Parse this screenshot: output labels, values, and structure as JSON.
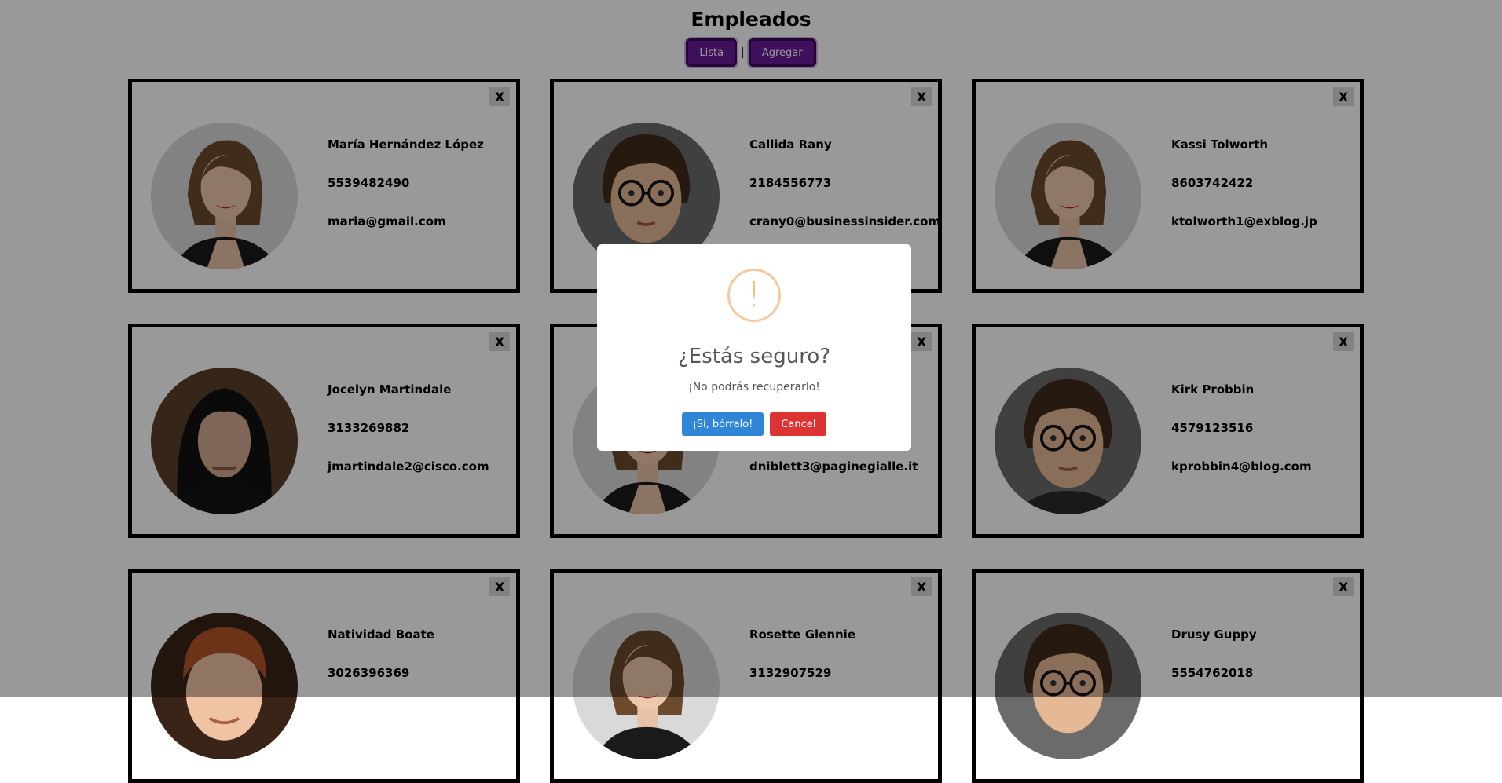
{
  "header": {
    "title": "Empleados",
    "nav": {
      "list_label": "Lista",
      "separator": "|",
      "add_label": "Agregar"
    }
  },
  "cards": [
    {
      "name": "María Hernández López",
      "phone": "5539482490",
      "email": "maria@gmail.com",
      "avatar": "woman-brown-hair-photo",
      "close_label": "X"
    },
    {
      "name": "Callida Rany",
      "phone": "2184556773",
      "email": "crany0@businessinsider.com",
      "avatar": "young-man-glasses-photo",
      "close_label": "X"
    },
    {
      "name": "Kassi Tolworth",
      "phone": "8603742422",
      "email": "ktolworth1@exblog.jp",
      "avatar": "woman-brown-hair-photo",
      "close_label": "X"
    },
    {
      "name": "Jocelyn Martindale",
      "phone": "3133269882",
      "email": "jmartindale2@cisco.com",
      "avatar": "man-long-black-hair-photo",
      "close_label": "X"
    },
    {
      "name": "",
      "phone": "",
      "email": "dniblett3@paginegialle.it",
      "avatar": "woman-brown-hair-photo",
      "close_label": "X"
    },
    {
      "name": "Kirk Probbin",
      "phone": "4579123516",
      "email": "kprobbin4@blog.com",
      "avatar": "young-man-glasses-photo",
      "close_label": "X"
    },
    {
      "name": "Natividad Boate",
      "phone": "3026396369",
      "email": "",
      "avatar": "man-red-hair-photo",
      "close_label": "X"
    },
    {
      "name": "Rosette Glennie",
      "phone": "3132907529",
      "email": "",
      "avatar": "woman-brown-hair-photo",
      "close_label": "X"
    },
    {
      "name": "Drusy Guppy",
      "phone": "5554762018",
      "email": "",
      "avatar": "young-man-glasses-photo",
      "close_label": "X"
    }
  ],
  "dialog": {
    "icon": "exclamation-icon",
    "icon_glyph": "!",
    "title": "¿Estás seguro?",
    "text": "¡No podrás recuperarlo!",
    "confirm_label": "¡Sí, bórralo!",
    "cancel_label": "Cancel"
  },
  "colors": {
    "nav_button": "#6a1b9a",
    "overlay": "#00000066",
    "confirm": "#3085d6",
    "cancel": "#dd3333",
    "warning": "#f8bb86"
  }
}
